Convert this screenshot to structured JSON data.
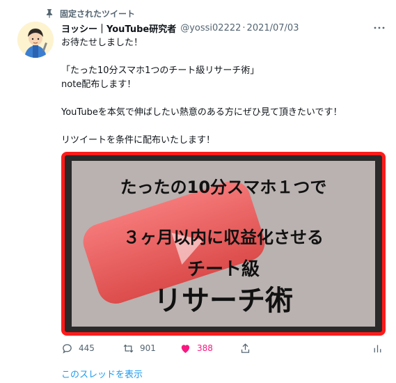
{
  "pinned": {
    "label": "固定されたツイート"
  },
  "author": {
    "name": "ヨッシー｜YouTube研究者",
    "handle": "@yossi02222",
    "separator": "·",
    "date": "2021/07/03"
  },
  "tweet": {
    "lines": [
      "お待たせしました！",
      "",
      "「たった10分スマホ1つのチート級リサーチ術」",
      "note配布します！",
      "",
      "YouTubeを本気で伸ばしたい熱意のある方にぜひ見て頂きたいです！",
      "",
      "リツイートを条件に配布いたします！"
    ]
  },
  "media": {
    "line1": "たったの10分スマホ１つで",
    "line2": "３ヶ月以内に収益化させる",
    "line3": "チート級",
    "line4": "リサーチ術",
    "border_color": "#ff1b1b"
  },
  "actions": {
    "reply_count": "445",
    "retweet_count": "901",
    "like_count": "388",
    "like_color": "#f91880"
  },
  "thread_link": {
    "label": "このスレッドを表示"
  },
  "colors": {
    "accent": "#1d9bf0",
    "muted": "#536471",
    "text": "#0f1419"
  }
}
